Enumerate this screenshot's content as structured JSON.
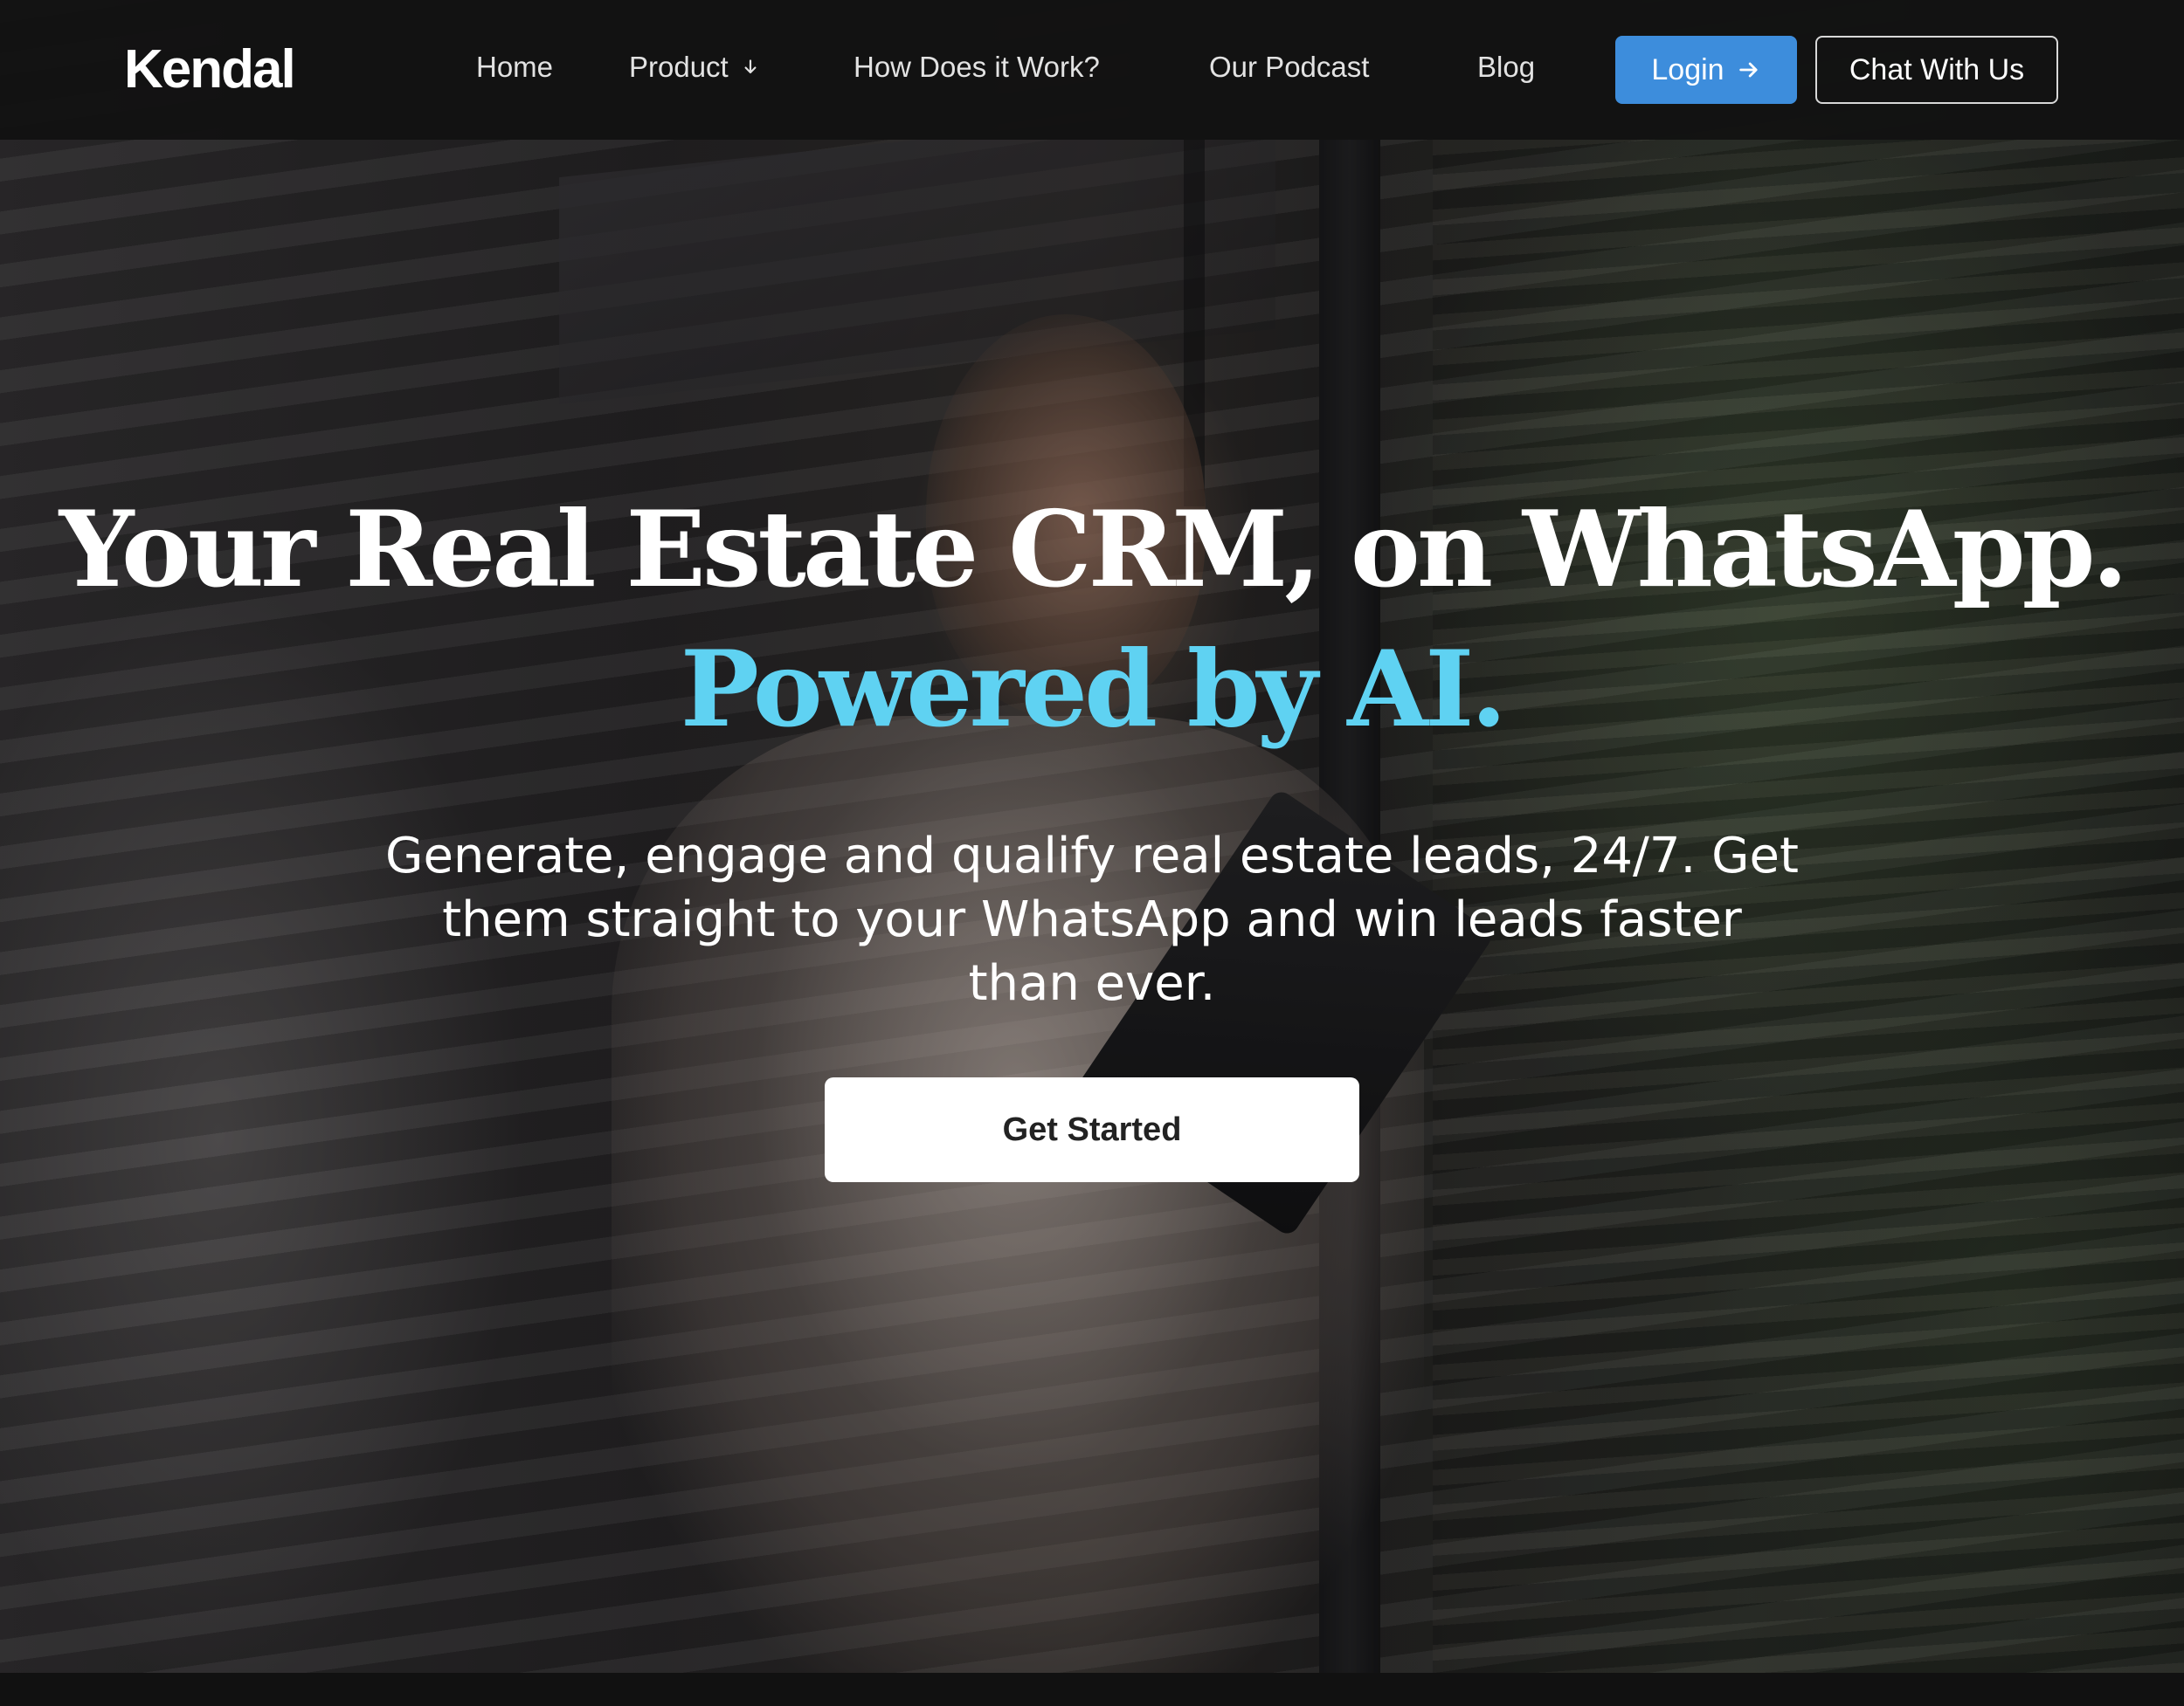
{
  "brand": {
    "logo_text": "Kendal"
  },
  "nav": {
    "links": [
      {
        "label": "Home"
      },
      {
        "label": "Product",
        "icon": "chevron-down-icon"
      },
      {
        "label": "How Does it Work?"
      },
      {
        "label": "Our Podcast"
      },
      {
        "label": "Blog"
      }
    ],
    "login_label": "Login",
    "login_icon": "arrow-right-icon",
    "chat_label": "Chat With Us"
  },
  "hero": {
    "headline": "Your Real Estate CRM, on WhatsApp.",
    "headline_accent": "Powered by AI.",
    "subtext": "Generate, engage and qualify real estate leads, 24/7.  Get them straight to your WhatsApp and win leads faster than ever.",
    "cta_label": "Get Started"
  },
  "colors": {
    "accent_text": "#5fd2f2",
    "login_button": "#3d8ddc",
    "nav_background": "#121212"
  }
}
